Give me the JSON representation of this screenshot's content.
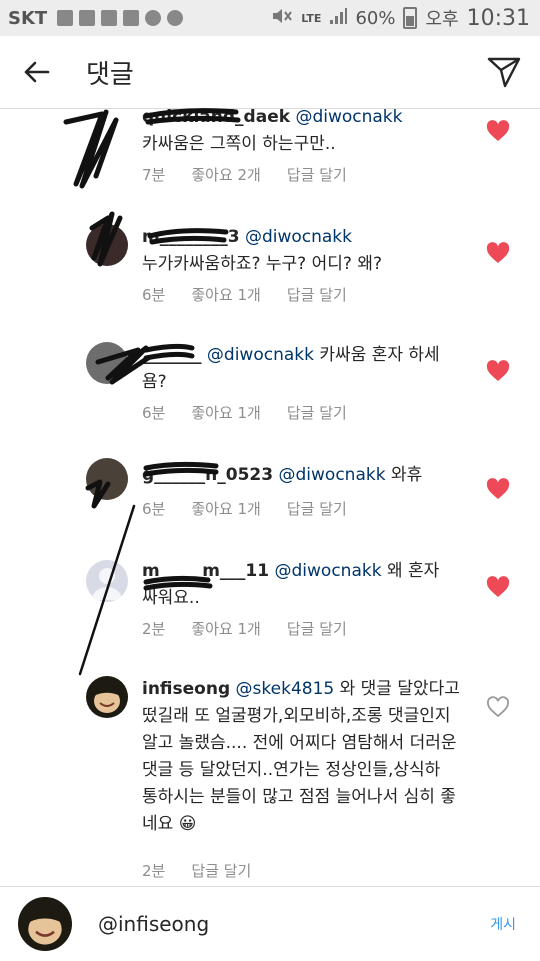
{
  "status_bar": {
    "carrier": "SKT",
    "lte": "LTE",
    "battery": "60%",
    "ampm": "오후",
    "time": "10:31"
  },
  "header": {
    "title": "댓글"
  },
  "comments": [
    {
      "username": "quickland_daek",
      "mention": "@diwocnakk",
      "text": "카싸움은 그쪽이 하는구만..",
      "time": "7분",
      "likes": "좋아요 2개",
      "reply": "답글 달기",
      "liked": true
    },
    {
      "username": "m________3",
      "mention": "@diwocnakk",
      "text": "누가카싸움하죠? 누구? 어디? 왜?",
      "time": "6분",
      "likes": "좋아요 1개",
      "reply": "답글 달기",
      "liked": true
    },
    {
      "username": "_______",
      "mention": "@diwocnakk",
      "text": "카싸움 혼자 하세욤?",
      "time": "6분",
      "likes": "좋아요 1개",
      "reply": "답글 달기",
      "liked": true
    },
    {
      "username": "g______n_0523",
      "mention": "@diwocnakk",
      "text": "와휴",
      "time": "6분",
      "likes": "좋아요 1개",
      "reply": "답글 달기",
      "liked": true
    },
    {
      "username": "m_____m___11",
      "mention": "@diwocnakk",
      "text": "왜 혼자 싸워요..",
      "time": "2분",
      "likes": "좋아요 1개",
      "reply": "답글 달기",
      "liked": true
    },
    {
      "username": "infiseong",
      "mention": "@skek4815",
      "text": "와 댓글 달았다고 떴길래 또 얼굴평가,외모비하,조롱 댓글인지알고 놀랬슴.... 전에 어찌다 염탐해서 더러운 댓글 등 달았던지..연가는 정상인들,상식하 통하시는 분들이 많고 점점 늘어나서 심히 좋네요",
      "emoji": "😀",
      "time": "2분",
      "reply": "답글 달기",
      "liked": false
    }
  ],
  "reply_bar": {
    "value": "@infiseong",
    "post_label": "게시"
  },
  "colors": {
    "heart_liked": "#ed4956",
    "mention": "#003569",
    "meta": "#8e8e8e",
    "post": "#3897f0"
  }
}
